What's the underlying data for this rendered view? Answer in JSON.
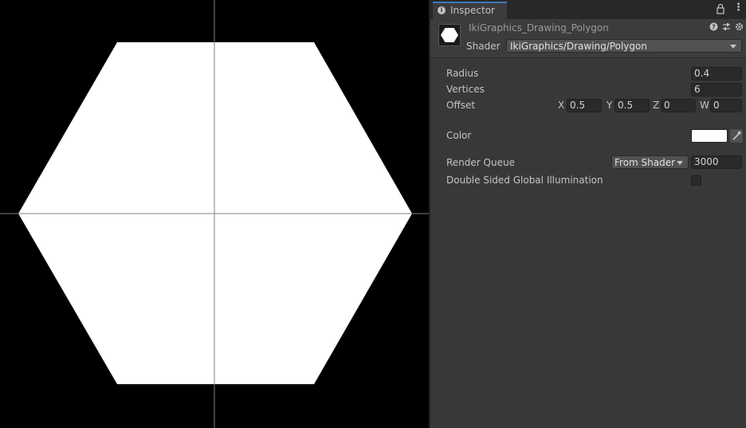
{
  "preview": {
    "shape": "hexagon",
    "fill_color": "#ffffff",
    "background_color": "#000000",
    "crosshair_color": "#808080"
  },
  "tab": {
    "label": "Inspector",
    "icon": "info-icon"
  },
  "header": {
    "material_name": "IkiGraphics_Drawing_Polygon",
    "shader_label": "Shader",
    "shader_value": "IkiGraphics/Drawing/Polygon"
  },
  "properties": {
    "radius_label": "Radius",
    "radius_value": "0.4",
    "vertices_label": "Vertices",
    "vertices_value": "6",
    "offset_label": "Offset",
    "offset": {
      "x_label": "X",
      "x": "0.5",
      "y_label": "Y",
      "y": "0.5",
      "z_label": "Z",
      "z": "0",
      "w_label": "W",
      "w": "0"
    },
    "color_label": "Color",
    "color_value": "#ffffff",
    "render_queue_label": "Render Queue",
    "render_queue_mode": "From Shader",
    "render_queue_value": "3000",
    "dsgi_label": "Double Sided Global Illumination",
    "dsgi_checked": false
  },
  "colors": {
    "accent": "#3a79bb",
    "panel_bg": "#383838"
  }
}
